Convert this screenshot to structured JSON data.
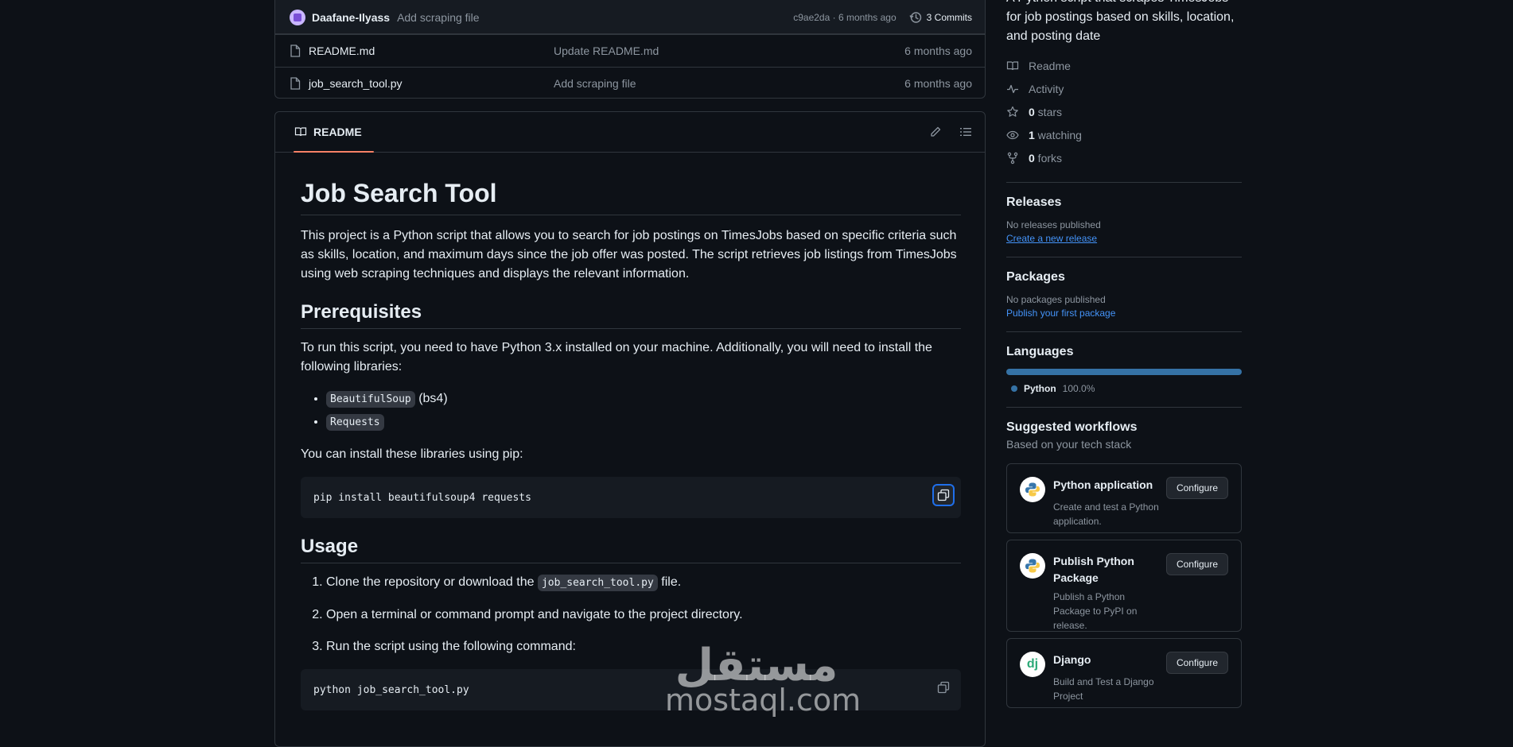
{
  "latest_commit": {
    "author": "Daafane-Ilyass",
    "message": "Add scraping file",
    "meta": "c9ae2da · 6 months ago",
    "commits": "3 Commits"
  },
  "files": [
    {
      "name": "README.md",
      "commit": "Update README.md",
      "date": "6 months ago"
    },
    {
      "name": "job_search_tool.py",
      "commit": "Add scraping file",
      "date": "6 months ago"
    }
  ],
  "readme": {
    "tab": "README",
    "h1": "Job Search Tool",
    "intro": "This project is a Python script that allows you to search for job postings on TimesJobs based on specific criteria such as skills, location, and maximum days since the job offer was posted. The script retrieves job listings from TimesJobs using web scraping techniques and displays the relevant information.",
    "h2_prereq": "Prerequisites",
    "prereq_text": "To run this script, you need to have Python 3.x installed on your machine. Additionally, you will need to install the following libraries:",
    "libs": [
      {
        "code": "BeautifulSoup",
        "suffix": " (bs4)"
      },
      {
        "code": "Requests",
        "suffix": ""
      }
    ],
    "install_text": "You can install these libraries using pip:",
    "install_cmd": "pip install beautifulsoup4 requests",
    "h2_usage": "Usage",
    "step1_pre": "Clone the repository or download the ",
    "step1_code": "job_search_tool.py",
    "step1_post": " file.",
    "step2": "Open a terminal or command prompt and navigate to the project directory.",
    "step3": "Run the script using the following command:",
    "run_cmd": "python job_search_tool.py"
  },
  "sidebar": {
    "about": "A Python script that scrapes TimesJobs for job postings based on skills, location, and posting date",
    "readme": "Readme",
    "activity": "Activity",
    "stars_count": "0",
    "stars_label": " stars",
    "watching_count": "1",
    "watching_label": " watching",
    "forks_count": "0",
    "forks_label": " forks",
    "releases_title": "Releases",
    "releases_none": "No releases published",
    "releases_link": "Create a new release",
    "packages_title": "Packages",
    "packages_none": "No packages published",
    "packages_link": "Publish your first package",
    "languages_title": "Languages",
    "language_name": "Python",
    "language_pct": "100.0%",
    "language_share": 100,
    "language_color": "#3572a5",
    "workflows_title": "Suggested workflows",
    "workflows_sub": "Based on your tech stack",
    "configure_label": "Configure",
    "workflows": [
      {
        "title": "Python application",
        "desc": "Create and test a Python application.",
        "logo": "python-logo-icon"
      },
      {
        "title": "Publish Python Package",
        "desc": "Publish a Python Package to PyPI on release.",
        "logo": "python-logo-icon"
      },
      {
        "title": "Django",
        "desc": "Build and Test a Django Project",
        "logo": "django-logo-icon",
        "logo_text": "dj"
      }
    ]
  },
  "watermark": {
    "arabic": "مستقل",
    "latin": "mostaql.com"
  },
  "colors": {
    "accent": "#4493f8",
    "tab_underline": "#f78166",
    "background": "#0d1117"
  }
}
